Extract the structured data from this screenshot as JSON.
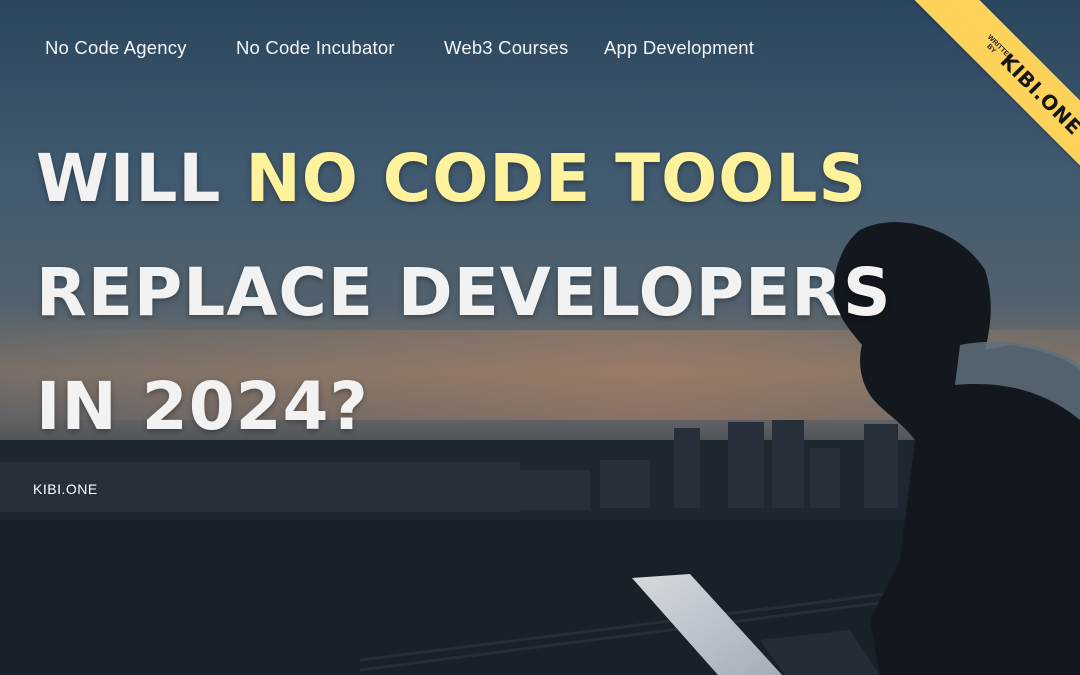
{
  "nav": {
    "items": [
      {
        "label": "No Code Agency"
      },
      {
        "label": "No Code Incubator"
      },
      {
        "label": "Web3 Courses"
      },
      {
        "label": "App Development"
      }
    ]
  },
  "hero": {
    "line1_pre": "WILL ",
    "line1_highlight": "NO CODE TOOLS",
    "line2": "REPLACE DEVELOPERS",
    "line3": "IN 2024?",
    "highlight_color": "#fff29c"
  },
  "brand": {
    "label": "KIBI.ONE"
  },
  "ribbon": {
    "small_text": "WRITTEN BY",
    "big_text": "KIBI.ONE",
    "color": "#fcd25a"
  },
  "photo": {
    "icons": [
      "person-silhouette-icon",
      "laptop-icon",
      "city-skyline-icon"
    ]
  }
}
